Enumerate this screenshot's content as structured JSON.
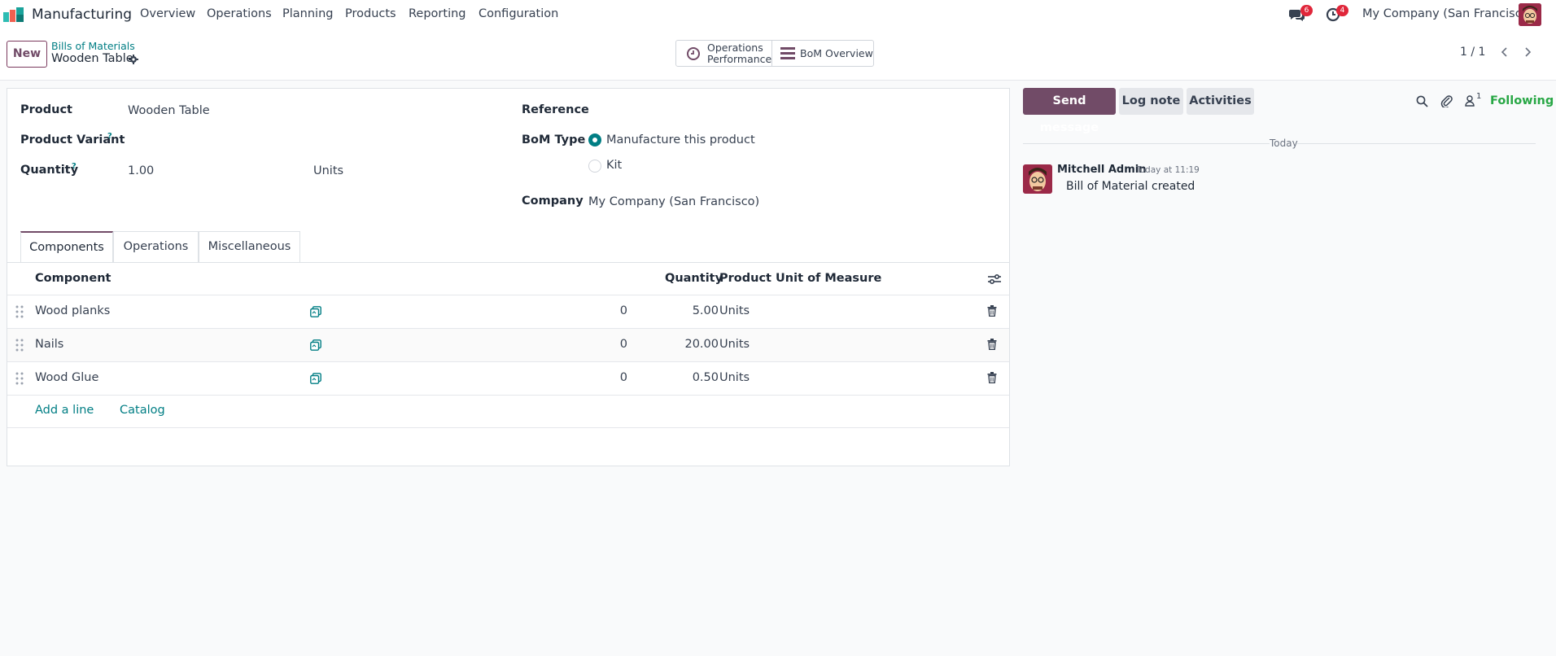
{
  "nav": {
    "app_name": "Manufacturing",
    "menu": [
      "Overview",
      "Operations",
      "Planning",
      "Products",
      "Reporting",
      "Configuration"
    ],
    "messages_count": "6",
    "activities_count": "4",
    "company": "My Company (San Francisco)"
  },
  "control": {
    "new_label": "New",
    "breadcrumb_parent": "Bills of Materials",
    "record_title": "Wooden Table",
    "smart_ops_line1": "Operations",
    "smart_ops_line2": "Performance",
    "smart_bom": "BoM Overview",
    "pager": "1 / 1"
  },
  "form": {
    "product_label": "Product",
    "product_value": "Wooden Table",
    "variant_label": "Product Variant",
    "quantity_label": "Quantity",
    "quantity_value": "1.00",
    "quantity_uom": "Units",
    "help_mark": "?",
    "reference_label": "Reference",
    "bom_type_label": "BoM Type",
    "bom_type_options": [
      "Manufacture this product",
      "Kit"
    ],
    "bom_type_selected": "Manufacture this product",
    "company_label": "Company",
    "company_value": "My Company (San Francisco)"
  },
  "tabs": [
    "Components",
    "Operations",
    "Miscellaneous"
  ],
  "components": {
    "headers": {
      "component": "Component",
      "quantity": "Quantity",
      "uom": "Product Unit of Measure"
    },
    "rows": [
      {
        "name": "Wood planks",
        "avail": "0",
        "qty": "5.00",
        "uom": "Units"
      },
      {
        "name": "Nails",
        "avail": "0",
        "qty": "20.00",
        "uom": "Units"
      },
      {
        "name": "Wood Glue",
        "avail": "0",
        "qty": "0.50",
        "uom": "Units"
      }
    ],
    "add_line": "Add a line",
    "catalog": "Catalog"
  },
  "chatter": {
    "send_message": "Send message",
    "log_note": "Log note",
    "activities": "Activities",
    "followers_count": "1",
    "following": "Following",
    "date_separator": "Today",
    "messages": [
      {
        "author": "Mitchell Admin",
        "time": "Today at 11:19",
        "body": "Bill of Material created"
      }
    ]
  },
  "colors": {
    "brand": "#714b67",
    "link": "#017e84",
    "badge": "#e0263a",
    "following": "#28a745"
  }
}
